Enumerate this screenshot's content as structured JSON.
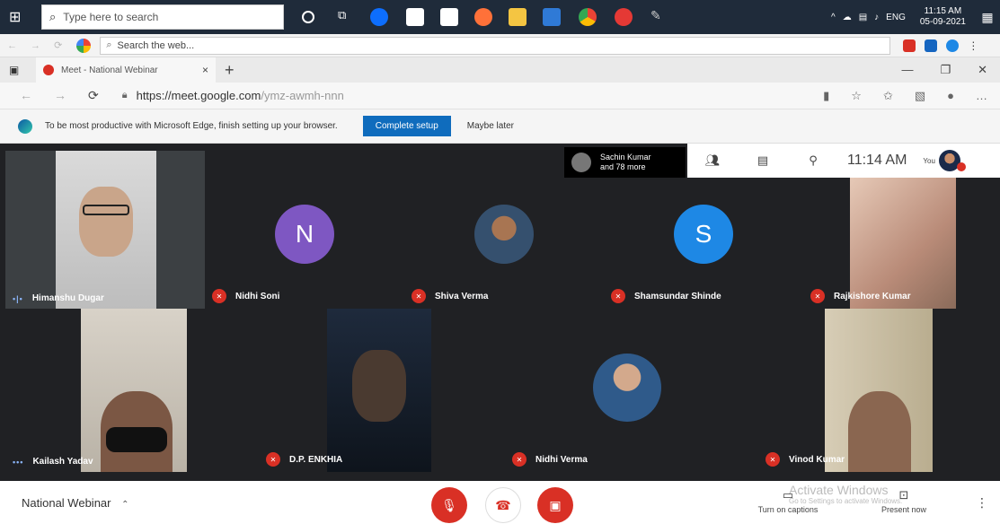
{
  "taskbar": {
    "search_placeholder": "Type here to search",
    "apps": [
      "task-view",
      "edge",
      "store",
      "mail",
      "firefox",
      "files",
      "outlook",
      "chrome",
      "google-plus",
      "feather"
    ],
    "tray_lang": "ENG",
    "time": "11:15 AM",
    "date": "05-09-2021"
  },
  "outer_browser": {
    "search_placeholder": "Search the web..."
  },
  "tab": {
    "title": "Meet - National Webinar",
    "close": "×",
    "new_tab": "+"
  },
  "address": {
    "url_main": "https://meet.google.com",
    "url_rest": "/ymz-awmh-nnn"
  },
  "infobar": {
    "message": "To be most productive with Microsoft Edge, finish setting up your browser.",
    "complete": "Complete setup",
    "maybe": "Maybe later"
  },
  "meet": {
    "people_chip": {
      "line1": "Sachin Kumar",
      "line2": "and 78 more"
    },
    "time": "11:14 AM",
    "you_label": "You",
    "tiles": [
      {
        "name": "Himanshu Dugar",
        "status": "speaking"
      },
      {
        "name": "Nidhi Soni",
        "status": "muted",
        "letter": "N",
        "color": "#7e57c2"
      },
      {
        "name": "Shiva Verma",
        "status": "muted"
      },
      {
        "name": "Shamsundar Shinde",
        "status": "muted",
        "letter": "S",
        "color": "#1e88e5"
      },
      {
        "name": "Rajkishore Kumar",
        "status": "muted"
      },
      {
        "name": "Kailash Yadav",
        "status": "speaking"
      },
      {
        "name": "D.P. ENKHIA",
        "status": "muted"
      },
      {
        "name": "Nidhi Verma",
        "status": "muted"
      },
      {
        "name": "Vinod Kumar",
        "status": "muted"
      }
    ]
  },
  "bottom": {
    "meeting_title": "National Webinar",
    "captions": "Turn on captions",
    "present": "Present now",
    "watermark": "Activate Windows",
    "watermark_sub": "Go to Settings to activate Windows."
  },
  "colors": {
    "taskbar": "#1f2b3a",
    "meet_bg": "#202124",
    "tile_bg": "#3c4043",
    "danger": "#d93025",
    "edge_blue": "#0f6cbd"
  }
}
